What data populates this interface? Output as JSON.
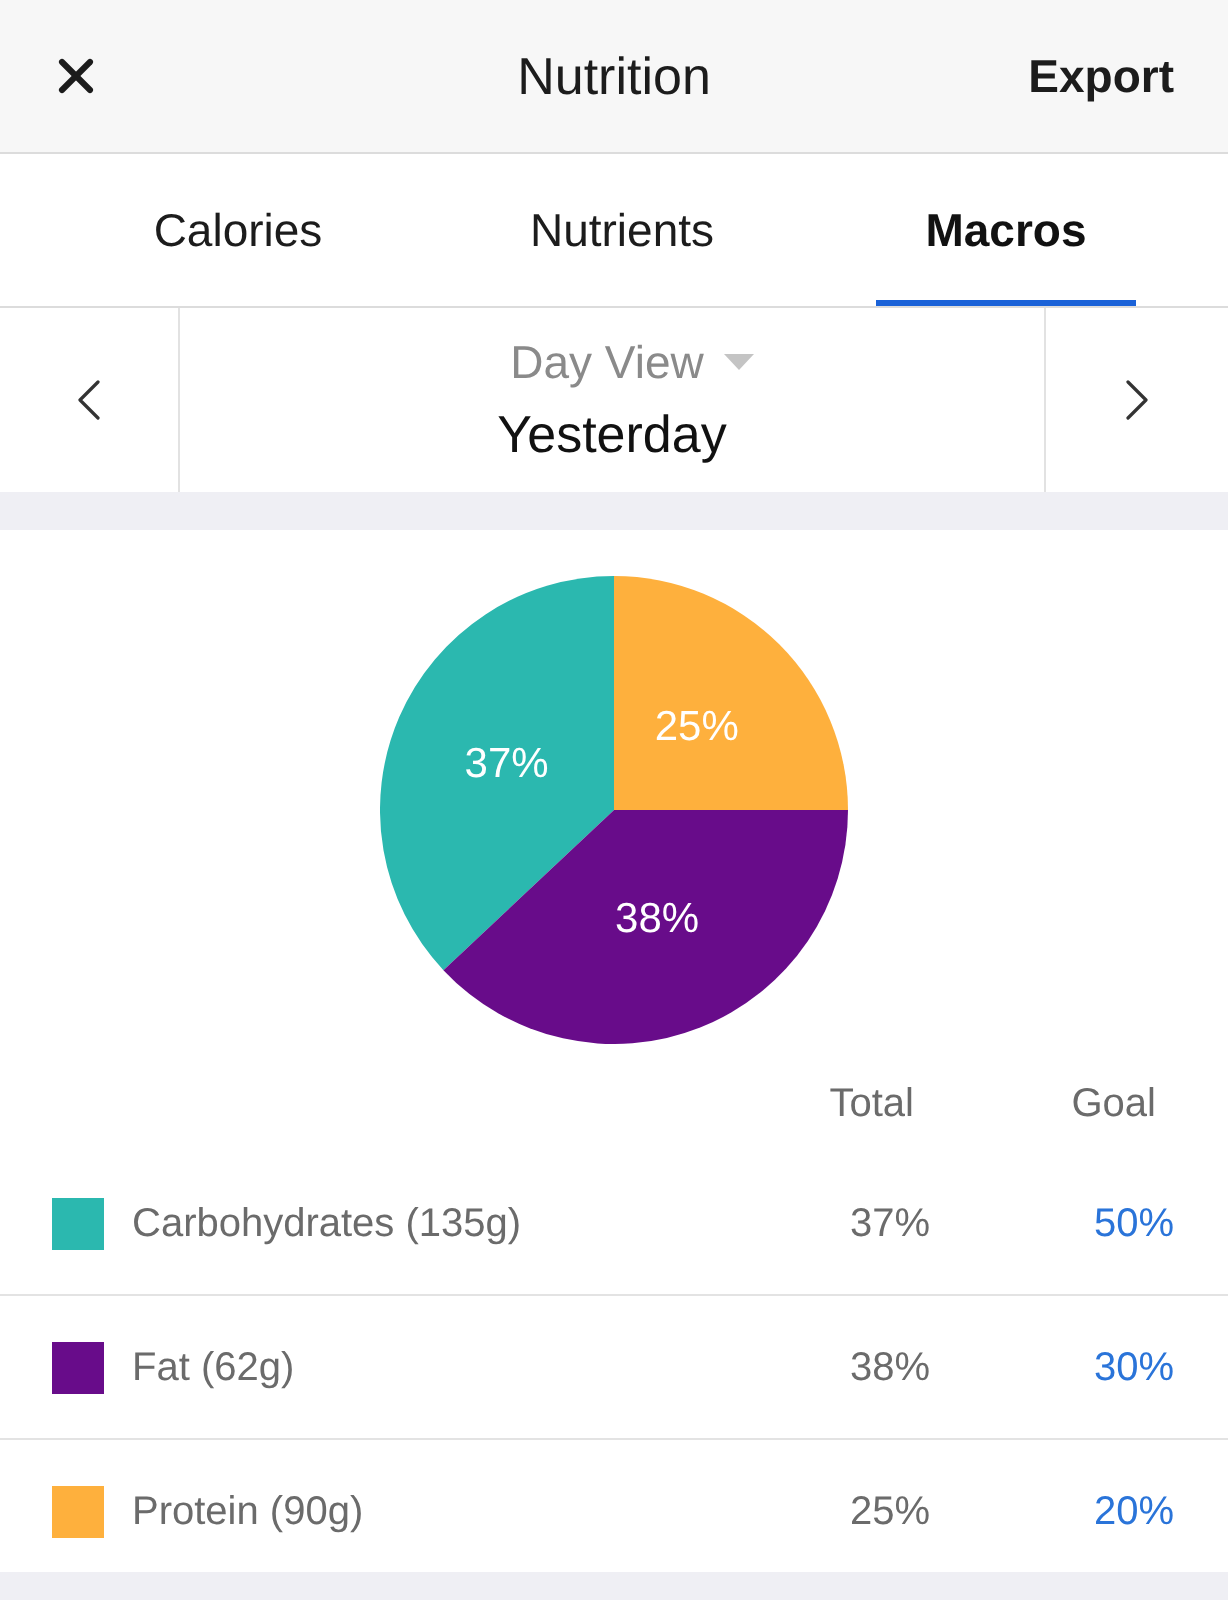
{
  "header": {
    "title": "Nutrition",
    "action": "Export"
  },
  "tabs": [
    {
      "label": "Calories",
      "selected": false
    },
    {
      "label": "Nutrients",
      "selected": false
    },
    {
      "label": "Macros",
      "selected": true
    }
  ],
  "date_nav": {
    "view": "Day View",
    "date": "Yesterday"
  },
  "macros": {
    "chart_data": {
      "type": "pie",
      "values": [
        37,
        38,
        25
      ],
      "colors": [
        "#2bb8af",
        "#680c8a",
        "#feb03d"
      ],
      "value_labels": [
        "37%",
        "38%",
        "25%"
      ]
    },
    "columns": [
      "Total",
      "Goal"
    ],
    "rows": [
      {
        "name": "Carbohydrates (135g)",
        "color": "#2bb8af",
        "total": "37%",
        "goal": "50%"
      },
      {
        "name": "Fat (62g)",
        "color": "#680c8a",
        "total": "38%",
        "goal": "30%"
      },
      {
        "name": "Protein (90g)",
        "color": "#feb03d",
        "total": "25%",
        "goal": "20%"
      }
    ]
  }
}
